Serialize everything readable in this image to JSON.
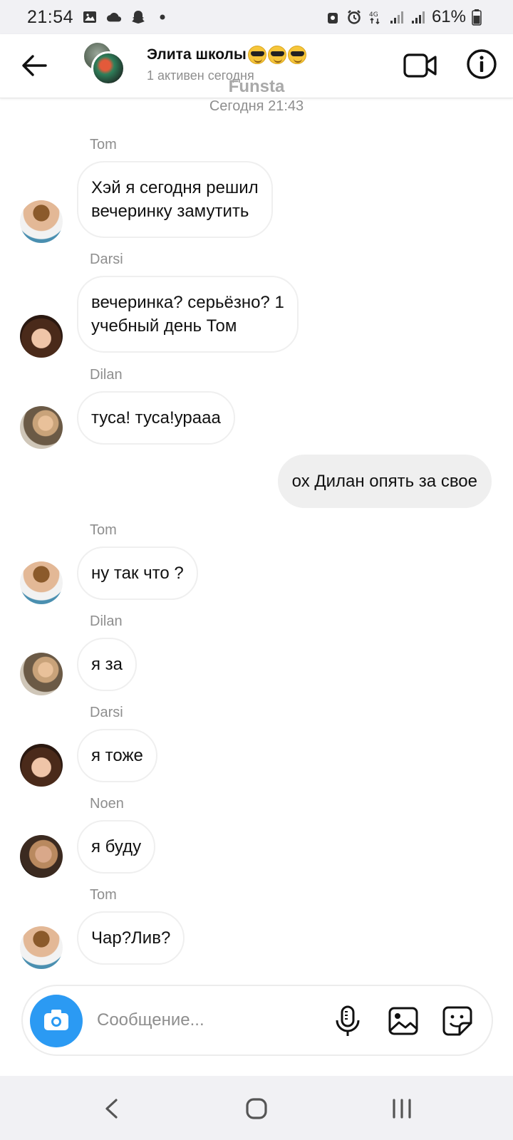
{
  "status_bar": {
    "time": "21:54",
    "network": "4G",
    "battery": "61%"
  },
  "header": {
    "title": "Элита школы",
    "title_emojis": [
      "smiling-face-with-sunglasses",
      "smiling-face-with-sunglasses",
      "smiling-face-with-sunglasses"
    ],
    "subtitle": "1 активен сегодня"
  },
  "chat": {
    "watermark": "Funsta",
    "date_label": "Сегодня 21:43",
    "messages": [
      {
        "sender": "Tom",
        "text_lines": [
          "Хэй я сегодня решил",
          "вечеринку замутить"
        ],
        "own": false
      },
      {
        "sender": "Darsi",
        "text_lines": [
          "вечеринка? серьёзно? 1",
          "учебный день Том"
        ],
        "own": false
      },
      {
        "sender": "Dilan",
        "text_lines": [
          "туса! туса!урааа"
        ],
        "own": false
      },
      {
        "sender": "",
        "text_lines": [
          "ох Дилан опять за свое"
        ],
        "own": true
      },
      {
        "sender": "Tom",
        "text_lines": [
          "ну так что ?"
        ],
        "own": false
      },
      {
        "sender": "Dilan",
        "text_lines": [
          "я за"
        ],
        "own": false
      },
      {
        "sender": "Darsi",
        "text_lines": [
          "я тоже"
        ],
        "own": false
      },
      {
        "sender": "Noen",
        "text_lines": [
          "я буду"
        ],
        "own": false
      },
      {
        "sender": "Tom",
        "text_lines": [
          "Чар?Лив?"
        ],
        "own": false
      }
    ]
  },
  "composer": {
    "placeholder": "Сообщение..."
  },
  "colors": {
    "accent": "#2b9af3",
    "own_bubble": "#efefef",
    "muted_text": "#8e8e8e",
    "system_bar": "#f1f1f4"
  }
}
